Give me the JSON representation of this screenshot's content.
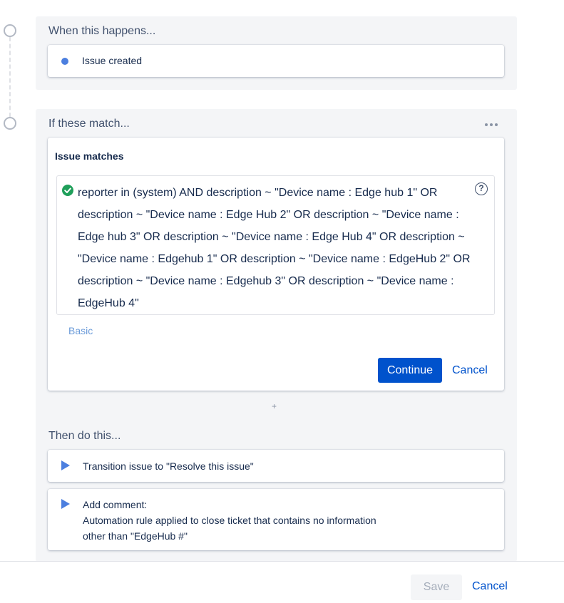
{
  "trigger": {
    "heading": "When this happens...",
    "item_label": "Issue created"
  },
  "condition": {
    "heading": "If these match...",
    "card_title": "Issue matches",
    "jql_lines": [
      "reporter in (system) AND description ~ \"Device name : Edge hub 1\" OR",
      "description ~ \"Device name : Edge Hub 2\" OR description ~ \"Device name :",
      "Edge hub 3\" OR description ~ \"Device name : Edge Hub 4\" OR description ~",
      "\"Device name : Edgehub 1\" OR description ~ \"Device name : EdgeHub 2\" OR",
      "description ~ \"Device name : Edgehub 3\" OR description ~ \"Device name :",
      "EdgeHub 4\""
    ],
    "help_glyph": "?",
    "basic_link": "Basic",
    "continue_label": "Continue",
    "cancel_label": "Cancel"
  },
  "add_component": "+",
  "actions": {
    "heading": "Then do this...",
    "items": [
      {
        "title": "Transition issue to \"Resolve this issue\""
      },
      {
        "title": "Add comment:",
        "line2": "Automation rule applied to close ticket that contains no information",
        "line3": "other than \"EdgeHub #\""
      }
    ]
  },
  "footer": {
    "save_label": "Save",
    "cancel_label": "Cancel"
  },
  "colors": {
    "primary": "#0052cc",
    "accent_blue": "#4c7fdf",
    "success_green": "#1f9f5a",
    "section_bg": "#f4f5f7"
  },
  "icons": {
    "timeline_node": "circle-outline",
    "trigger_bullet": "dot",
    "more": "ellipsis-horizontal",
    "jql_valid": "check-circle",
    "help": "question-circle",
    "action": "play-triangle"
  }
}
